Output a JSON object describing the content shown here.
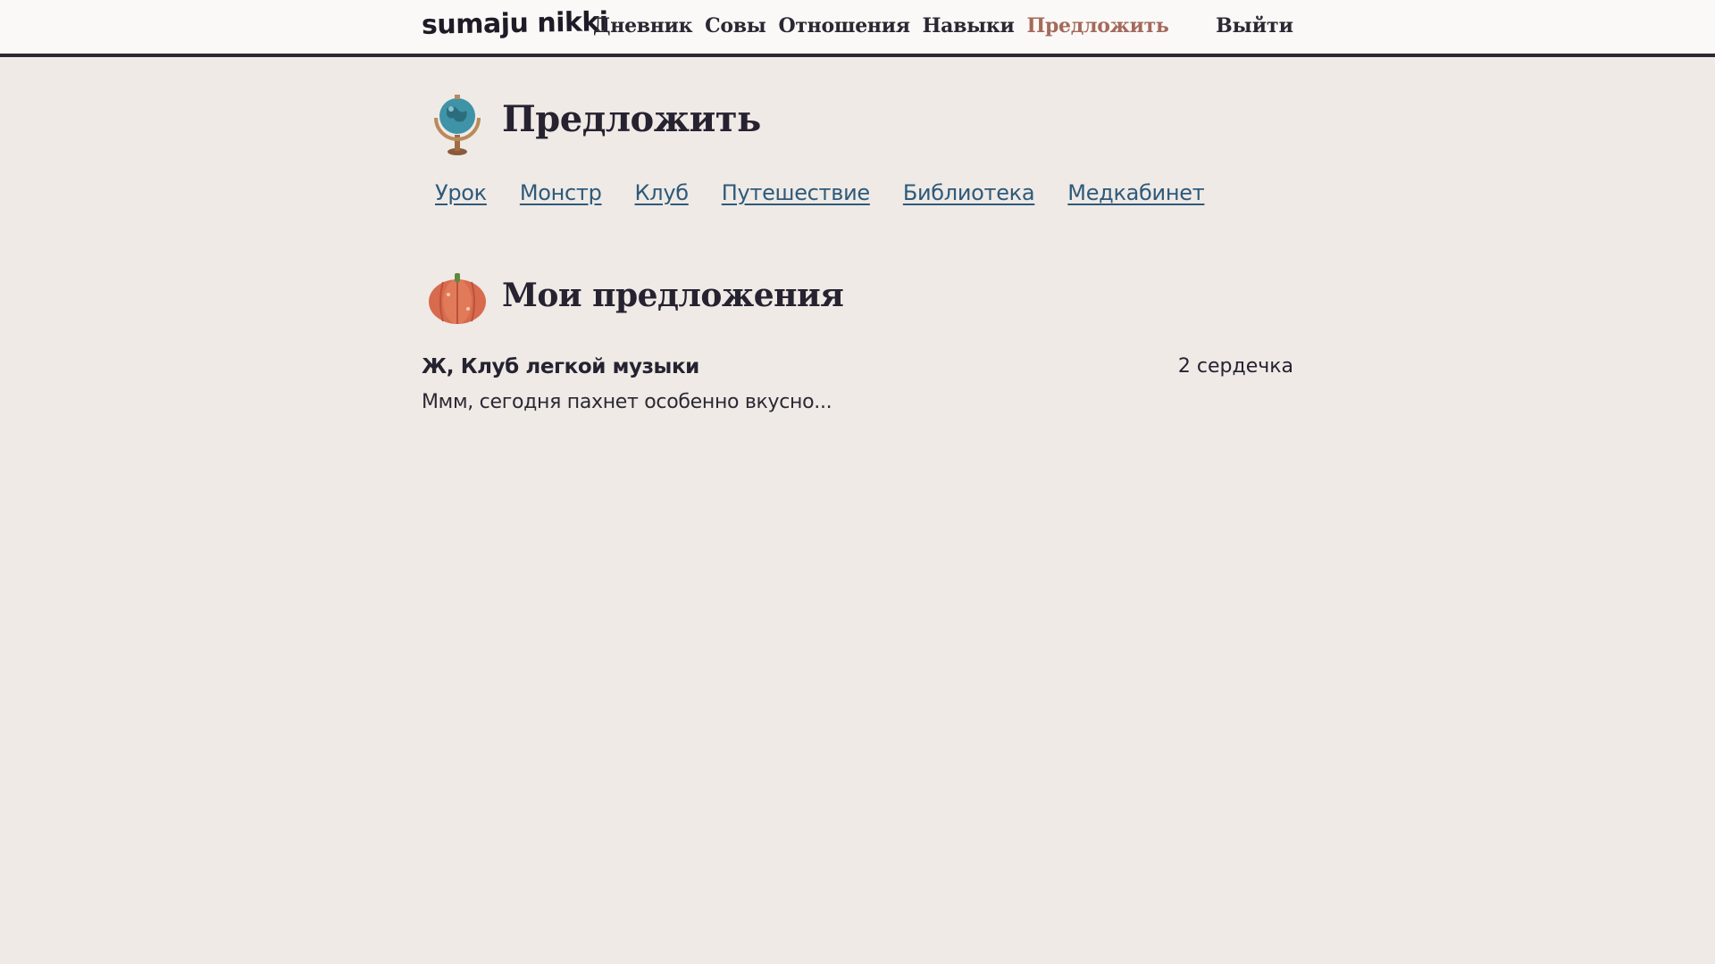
{
  "header": {
    "brand": "sumaju nikki",
    "nav": [
      {
        "label": "Дневник"
      },
      {
        "label": "Совы"
      },
      {
        "label": "Отношения"
      },
      {
        "label": "Навыки"
      },
      {
        "label": "Предложить",
        "active": true
      }
    ],
    "logout": "Выйти"
  },
  "page": {
    "title": "Предложить",
    "title_icon": "globe-icon",
    "categories": [
      "Урок",
      "Монстр",
      "Клуб",
      "Путешествие",
      "Библиотека",
      "Медкабинет"
    ]
  },
  "my_suggestions": {
    "title": "Мои предложения",
    "title_icon": "pumpkin-icon",
    "items": [
      {
        "title": "Ж, Клуб легкой музыки",
        "hearts": "2 сердечка",
        "text": "Ммм, сегодня пахнет особенно вкусно..."
      }
    ]
  },
  "colors": {
    "background": "#efeae6",
    "header_bg": "#fbf9f7",
    "text": "#262230",
    "active_nav": "#a46a5c",
    "link": "#2e5a7a"
  }
}
